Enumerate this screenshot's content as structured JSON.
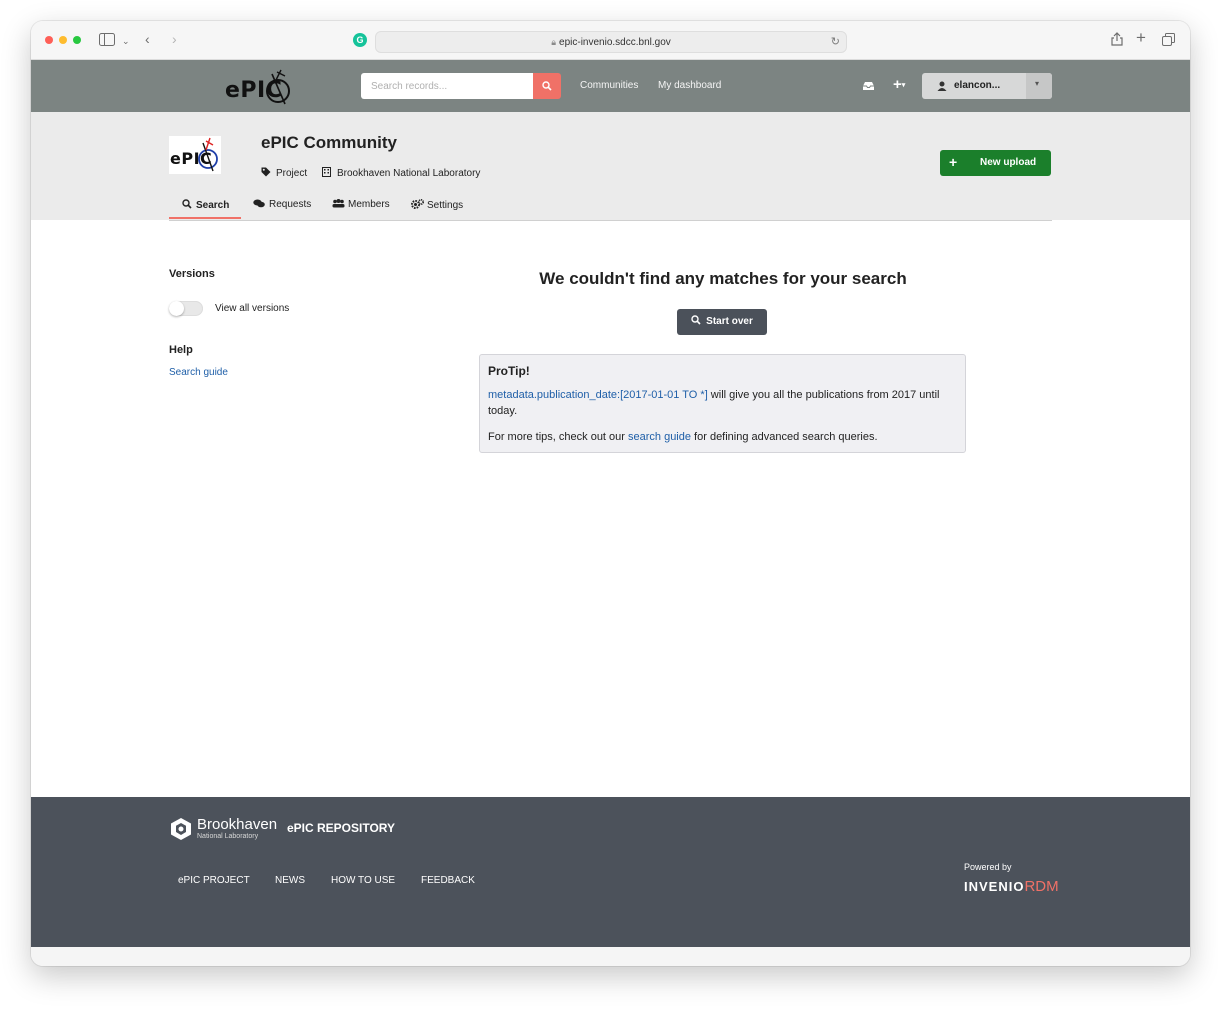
{
  "browser": {
    "url": "epic-invenio.sdcc.bnl.gov"
  },
  "header": {
    "logo_text": "ePIC",
    "search_placeholder": "Search records...",
    "nav": [
      "Communities",
      "My dashboard"
    ],
    "user_label": "elancon..."
  },
  "community": {
    "logo_text": "ePIC",
    "title": "ePIC Community",
    "type_label": "Project",
    "organization": "Brookhaven National Laboratory",
    "new_upload_label": "New upload",
    "tabs": [
      {
        "label": "Search",
        "icon": "search-icon",
        "active": true
      },
      {
        "label": "Requests",
        "icon": "comments-icon",
        "active": false
      },
      {
        "label": "Members",
        "icon": "users-icon",
        "active": false
      },
      {
        "label": "Settings",
        "icon": "cogs-icon",
        "active": false
      }
    ]
  },
  "sidebar": {
    "versions_title": "Versions",
    "view_all_versions_label": "View all versions",
    "view_all_versions_on": false,
    "help_title": "Help",
    "search_guide_link": "Search guide"
  },
  "results": {
    "empty_title": "We couldn't find any matches for your search",
    "start_over_label": "Start over",
    "protip": {
      "title": "ProTip!",
      "query_example": "metadata.publication_date:[2017-01-01 TO *]",
      "query_desc": " will give you all the publications from 2017 until today.",
      "more_prefix": "For more tips, check out our ",
      "more_link": "search guide",
      "more_suffix": " for defining advanced search queries."
    }
  },
  "footer": {
    "org_name": "Brookhaven",
    "org_sub": "National Laboratory",
    "repo_name": "ePIC REPOSITORY",
    "links": [
      "ePIC PROJECT",
      "NEWS",
      "HOW TO USE",
      "FEEDBACK"
    ],
    "powered_by": "Powered by",
    "invenio_text": "INVENIO",
    "rdm_text": "RDM"
  },
  "colors": {
    "header_bg": "#7c8482",
    "accent": "#f07167",
    "upload_green": "#1b7f2b",
    "footer_bg": "#4c525b",
    "link": "#1f5fa8"
  }
}
